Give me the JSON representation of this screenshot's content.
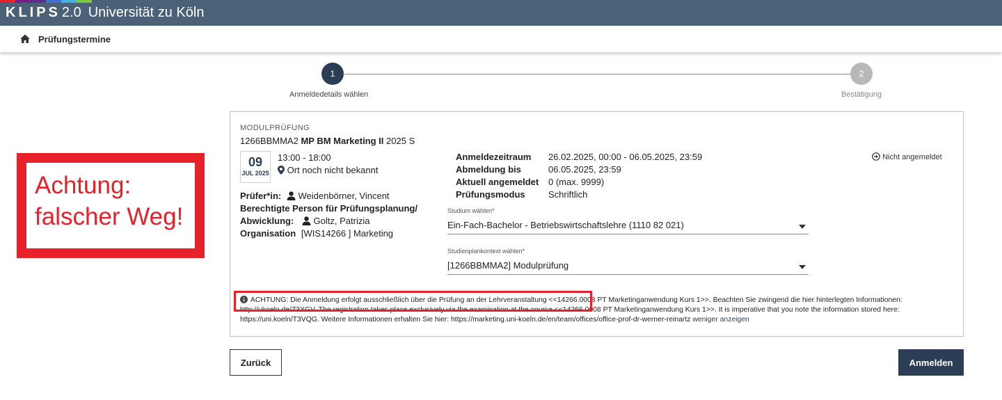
{
  "header": {
    "brand": "KLIPS",
    "version": "2.0",
    "university": "Universität zu Köln",
    "stripe_colors": [
      "#e8202a",
      "#7a1e8c",
      "#5b2d8a",
      "#3b6fd1",
      "#46b3e6",
      "#7ac943"
    ]
  },
  "breadcrumb": {
    "home_icon": "home-icon",
    "title": "Prüfungstermine"
  },
  "stepper": {
    "steps": [
      {
        "number": "1",
        "label": "Anmeldedetails wählen",
        "active": true
      },
      {
        "number": "2",
        "label": "Bestätigung",
        "active": false
      }
    ]
  },
  "warning_overlay": {
    "text": "Achtung:\nfalscher Weg!",
    "color": "#e8202a"
  },
  "card": {
    "type_label": "MODULPRÜFUNG",
    "code": "1266BBMMA2",
    "title": "MP BM Marketing II",
    "term": "2025 S",
    "date_day": "09",
    "date_month": "JUL 2025",
    "time": "13:00 - 18:00",
    "location": "Ort noch nicht bekannt",
    "examiner_label": "Prüfer*in:",
    "examiner": "Weidenbörner, Vincent",
    "planner_label_1": "Berechtigte Person für Prüfungsplanung/",
    "planner_label_2": "Abwicklung:",
    "planner": "Goltz, Patrizia",
    "org_label": "Organisation",
    "org_value": "[WIS14266 ] Marketing",
    "details": [
      {
        "label": "Anmeldezeitraum",
        "value": "26.02.2025, 00:00 - 06.05.2025, 23:59"
      },
      {
        "label": "Abmeldung bis",
        "value": "06.05.2025, 23:59"
      },
      {
        "label": "Aktuell angemeldet",
        "value": "0 (max. 9999)"
      },
      {
        "label": "Prüfungsmodus",
        "value": "Schriftlich"
      }
    ],
    "status": "Nicht angemeldet",
    "study_label": "Studium wählen*",
    "study_value": "Ein-Fach-Bachelor - Betriebswirtschaftslehre (1110 82 021)",
    "context_label": "Studienplankontext wählen*",
    "context_value": "[1266BBMMA2]  Modulprüfung",
    "info": "ACHTUNG: Die Anmeldung erfolgt ausschließlich über die Prüfung an der Lehrveranstaltung <<14266.0008 PT Marketinganwendung Kurs 1>>. Beachten Sie zwingend die hier hinterlegten Informationen: http://ukoeln.de/Z3XGV.   The registration takes place exclusively via the examination at the course <<14266.0008 PT Marketinganwendung Kurs 1>>. It is imperative that you note the information stored here: https://uni.koeln/T3VQG.  Weitere Informationen erhalten Sie hier: https://marketing.uni-koeln.de/en/team/offices/office-prof-dr-werner-reinartz",
    "info_link": "weniger anzeigen"
  },
  "buttons": {
    "back": "Zurück",
    "register": "Anmelden"
  }
}
